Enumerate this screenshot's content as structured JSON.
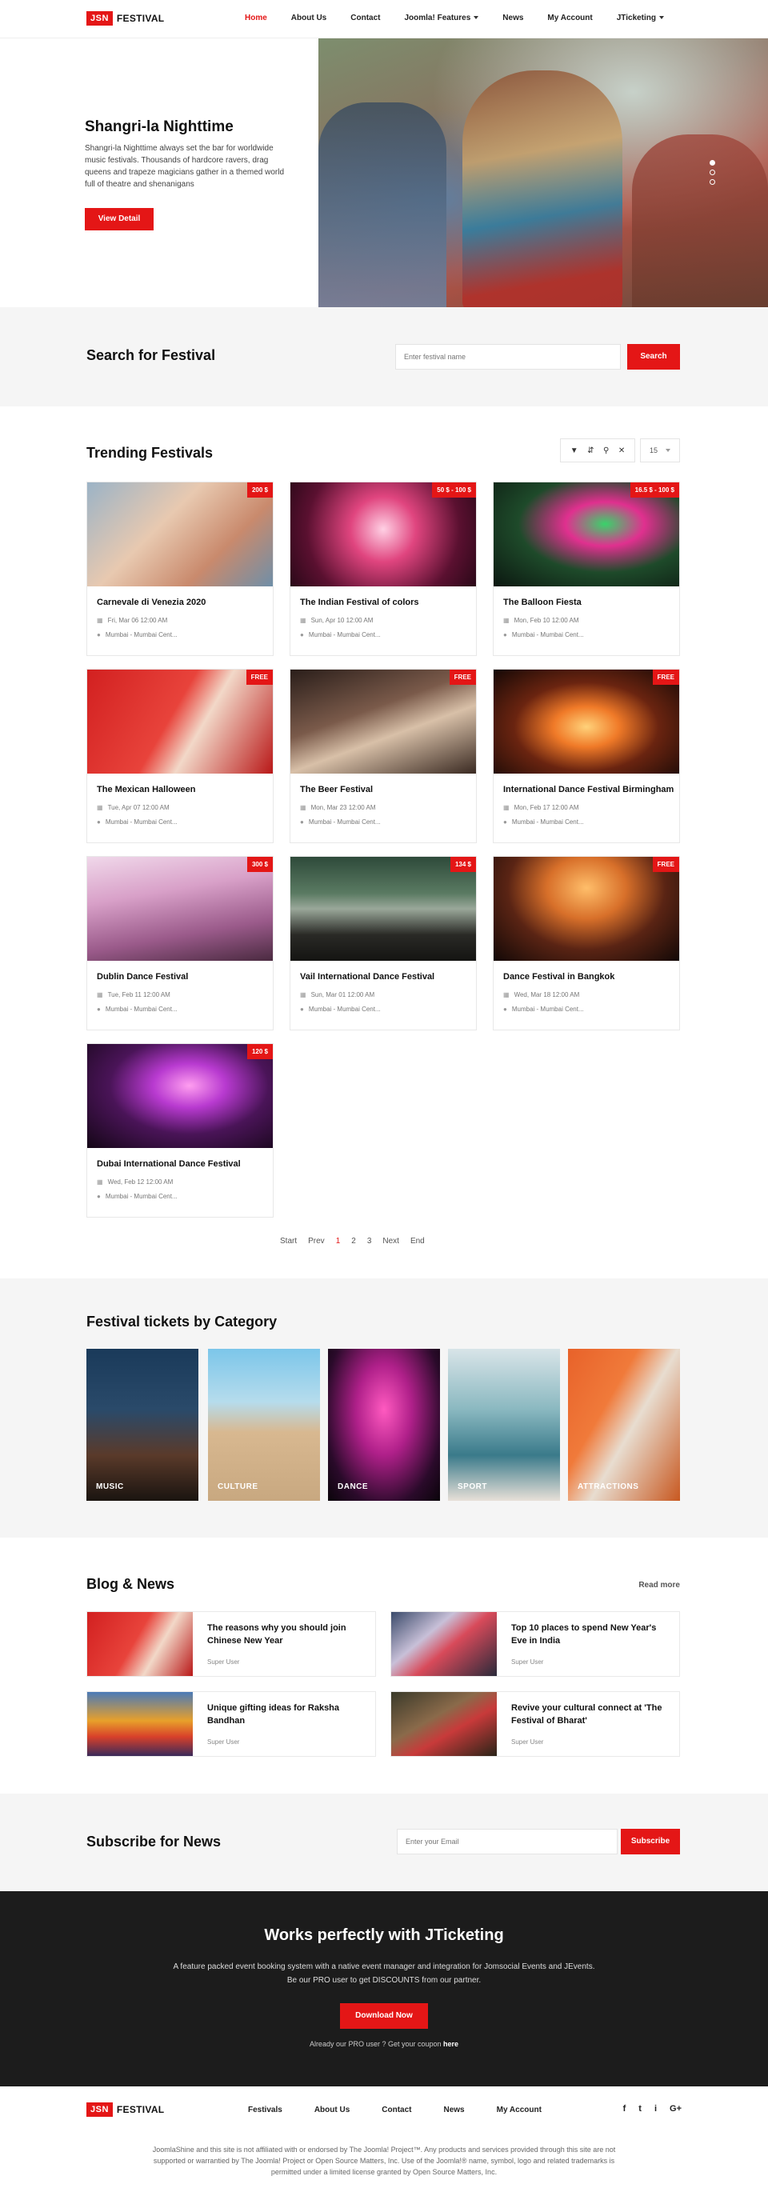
{
  "header": {
    "logo_box": "JSN",
    "logo_text": "FESTIVAL",
    "nav": [
      "Home",
      "About Us",
      "Contact",
      "Joomla! Features",
      "News",
      "My Account",
      "JTicketing"
    ]
  },
  "hero": {
    "title": "Shangri-la Nighttime",
    "description": "Shangri-la Nighttime always set the bar for worldwide music festivals. Thousands of hardcore ravers, drag queens and trapeze magicians gather in a themed world full of theatre and shenanigans",
    "button": "View Detail",
    "image": "festival-crowd-photo"
  },
  "search": {
    "title": "Search for Festival",
    "placeholder": "Enter festival name",
    "button": "Search"
  },
  "trending": {
    "title": "Trending Festivals",
    "filter_icons": [
      "filter-icon",
      "sort-icon",
      "search-icon",
      "close-icon"
    ],
    "limit": "15",
    "cards": [
      {
        "title": "Carnevale di Venezia 2020",
        "price": "200 $",
        "date": "Fri, Mar 06 12:00 AM",
        "location": "Mumbai - Mumbai Cent..."
      },
      {
        "title": "The Indian Festival of colors",
        "price": "50 $ - 100 $",
        "date": "Sun, Apr 10 12:00 AM",
        "location": "Mumbai - Mumbai Cent..."
      },
      {
        "title": "The Balloon Fiesta",
        "price": "16.5 $ - 100 $",
        "date": "Mon, Feb 10 12:00 AM",
        "location": "Mumbai - Mumbai Cent..."
      },
      {
        "title": "The Mexican Halloween",
        "price": "FREE",
        "date": "Tue, Apr 07 12:00 AM",
        "location": "Mumbai - Mumbai Cent..."
      },
      {
        "title": "The Beer Festival",
        "price": "FREE",
        "date": "Mon, Mar 23 12:00 AM",
        "location": "Mumbai - Mumbai Cent..."
      },
      {
        "title": "International Dance Festival Birmingham",
        "price": "FREE",
        "date": "Mon, Feb 17 12:00 AM",
        "location": "Mumbai - Mumbai Cent..."
      },
      {
        "title": "Dublin Dance Festival",
        "price": "300 $",
        "date": "Tue, Feb 11 12:00 AM",
        "location": "Mumbai - Mumbai Cent..."
      },
      {
        "title": "Vail International Dance Festival",
        "price": "134 $",
        "date": "Sun, Mar 01 12:00 AM",
        "location": "Mumbai - Mumbai Cent..."
      },
      {
        "title": "Dance Festival in Bangkok",
        "price": "FREE",
        "date": "Wed, Mar 18 12:00 AM",
        "location": "Mumbai - Mumbai Cent..."
      },
      {
        "title": "Dubai International Dance Festival",
        "price": "120 $",
        "date": "Wed, Feb 12 12:00 AM",
        "location": "Mumbai - Mumbai Cent..."
      }
    ],
    "pagination": [
      "Start",
      "Prev",
      "1",
      "2",
      "3",
      "Next",
      "End"
    ],
    "current_page": "1"
  },
  "categories": {
    "title": "Festival tickets by Category",
    "items": [
      "MUSIC",
      "CULTURE",
      "DANCE",
      "SPORT",
      "ATTRACTIONS"
    ]
  },
  "blog": {
    "title": "Blog & News",
    "read_more": "Read more",
    "posts": [
      {
        "title": "The reasons why you should join Chinese New Year",
        "author": "Super User"
      },
      {
        "title": "Top 10 places to spend New Year's Eve in India",
        "author": "Super User"
      },
      {
        "title": "Unique gifting ideas for Raksha Bandhan",
        "author": "Super User"
      },
      {
        "title": "Revive your cultural connect at 'The Festival of Bharat'",
        "author": "Super User"
      }
    ]
  },
  "subscribe": {
    "title": "Subscribe for News",
    "placeholder": "Enter your Email",
    "button": "Subscribe"
  },
  "promo": {
    "title": "Works perfectly with JTicketing",
    "line1": "A feature packed event booking system with a native event manager and integration for Jomsocial Events and JEvents.",
    "line2": "Be our PRO user to get DISCOUNTS from our partner.",
    "button": "Download Now",
    "coupon_prefix": "Already our PRO user ? Get your coupon",
    "coupon_link": "here"
  },
  "footer": {
    "nav": [
      "Festivals",
      "About Us",
      "Contact",
      "News",
      "My Account"
    ],
    "social": [
      "f",
      "t",
      "i",
      "G+"
    ],
    "disclaimer": "JoomlaShine and this site is not affiliated with or endorsed by The Joomla! Project™. Any products and services provided through this site are not supported or warrantied by The Joomla! Project or Open Source Matters, Inc. Use of the Joomla!® name, symbol, logo and related trademarks is permitted under a limited license granted by Open Source Matters, Inc."
  },
  "colors": {
    "accent": "#e41616",
    "dark": "#1c1c1c",
    "light_bg": "#f5f5f5"
  }
}
